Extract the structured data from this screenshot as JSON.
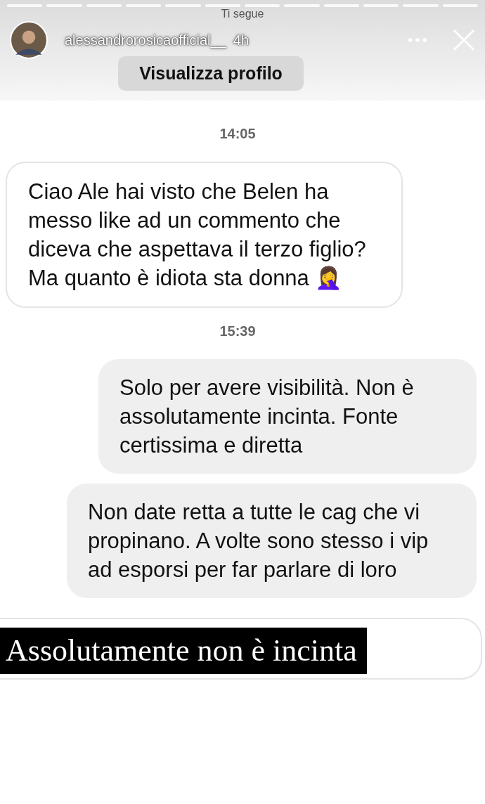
{
  "story": {
    "follow_label": "Ti segue",
    "username": "alessandrorosicaofficial__",
    "age": "4h",
    "profile_button": "Visualizza profilo"
  },
  "messages": [
    {
      "kind": "time",
      "text": "14:05"
    },
    {
      "kind": "received",
      "text": "Ciao Ale hai visto che Belen ha messo like ad un commento che diceva che aspettava il terzo figlio? Ma quanto è idiota sta donna 🤦‍♀️"
    },
    {
      "kind": "time",
      "text": "15:39"
    },
    {
      "kind": "sent",
      "text": "Solo per avere visibilità. Non è assolutamente incinta. Fonte certissima e diretta"
    },
    {
      "kind": "sent",
      "text": "Non date retta a tutte le cag che vi propinano. A volte sono stesso i vip ad esporsi per far parlare di loro"
    }
  ],
  "caption": "Assolutamente non è incinta"
}
